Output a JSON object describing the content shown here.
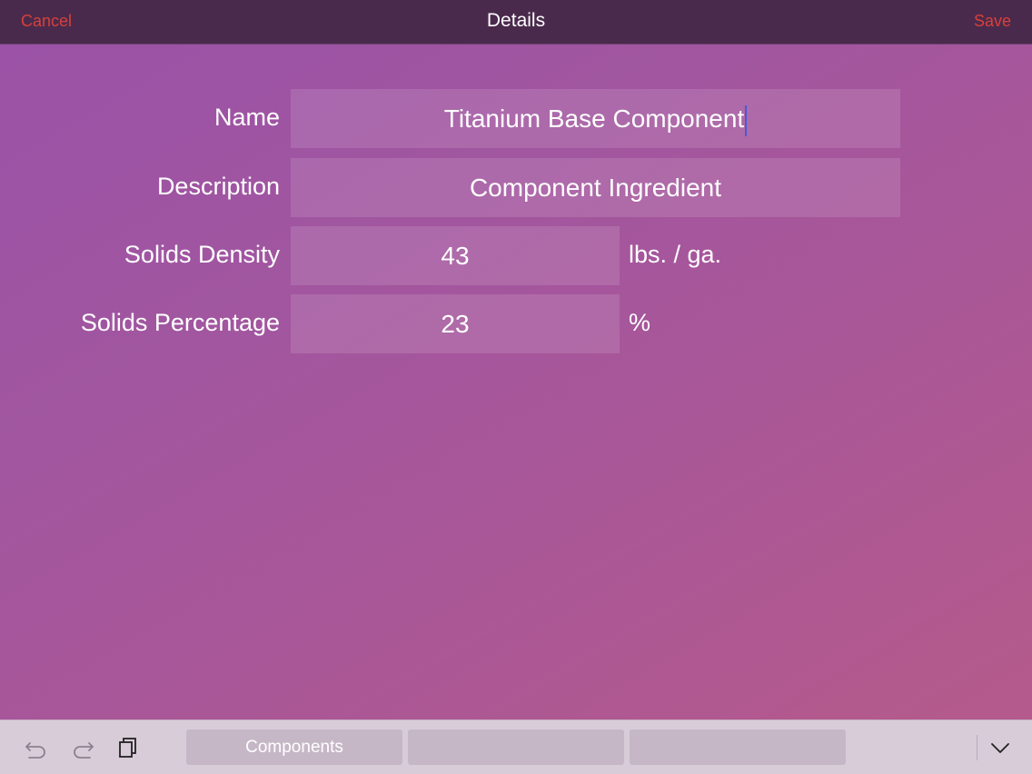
{
  "navbar": {
    "cancel_label": "Cancel",
    "title": "Details",
    "save_label": "Save",
    "action_color": "#d6403a"
  },
  "form": {
    "name_label": "Name",
    "name_value": "Titanium Base Component",
    "description_label": "Description",
    "description_value": "Component Ingredient",
    "density_label": "Solids Density",
    "density_value": "43",
    "density_unit": "lbs. / ga.",
    "percentage_label": "Solids Percentage",
    "percentage_value": "23",
    "percentage_unit": "%"
  },
  "toolbar": {
    "icons": [
      "undo-icon",
      "redo-icon",
      "clipboard-icon",
      "chevron-down-icon"
    ],
    "tabs": [
      "Components",
      "",
      ""
    ]
  }
}
